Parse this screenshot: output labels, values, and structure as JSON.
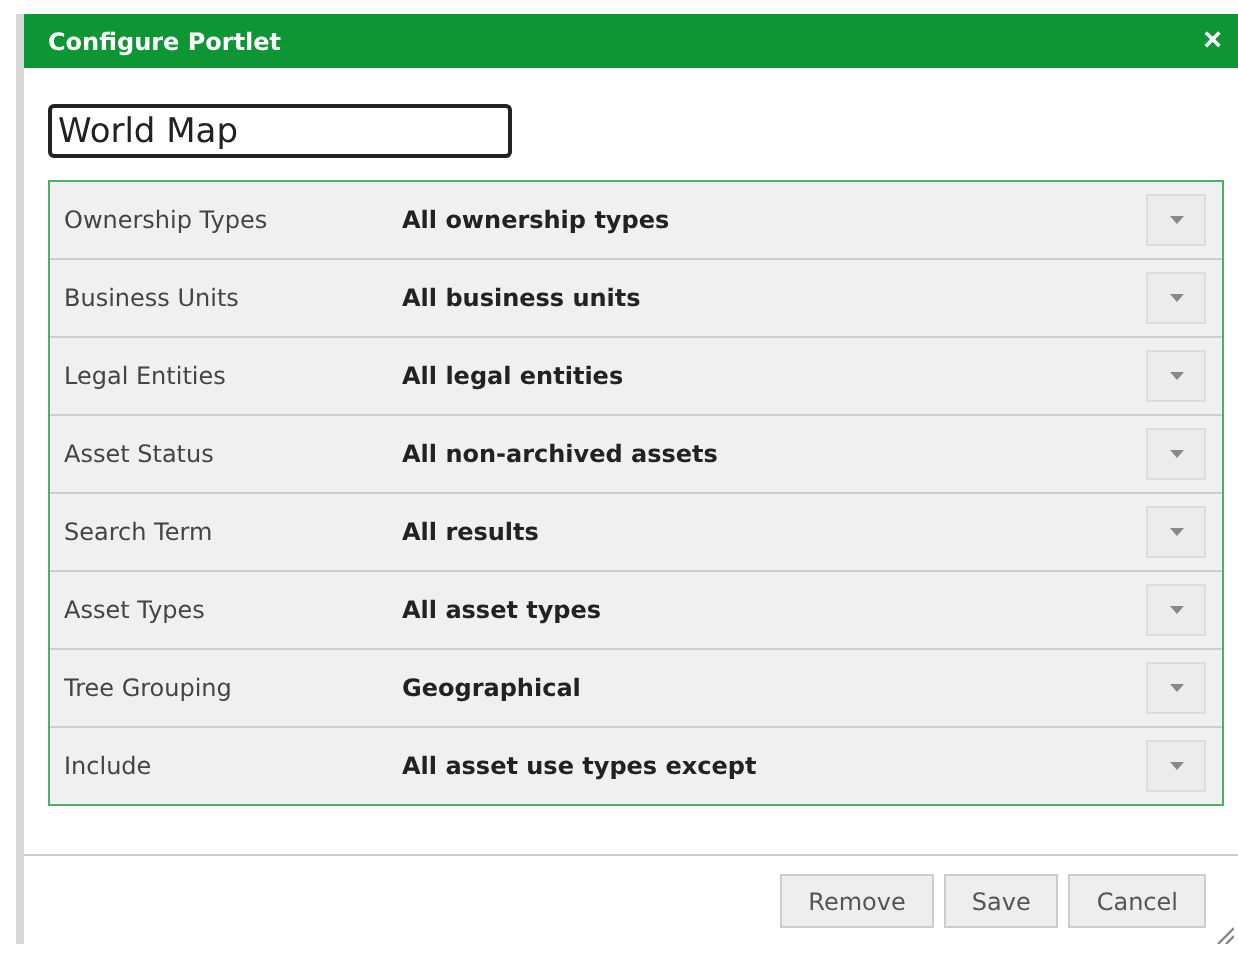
{
  "window": {
    "title": "Configure Portlet",
    "close": "×"
  },
  "name_field": {
    "value": "World Map"
  },
  "settings": [
    {
      "label": "Ownership Types",
      "value": "All ownership types"
    },
    {
      "label": "Business Units",
      "value": "All business units"
    },
    {
      "label": "Legal Entities",
      "value": "All legal entities"
    },
    {
      "label": "Asset Status",
      "value": "All non-archived assets"
    },
    {
      "label": "Search Term",
      "value": "All results"
    },
    {
      "label": "Asset Types",
      "value": "All asset types"
    },
    {
      "label": "Tree Grouping",
      "value": "Geographical"
    },
    {
      "label": "Include",
      "value": "All asset use types except"
    }
  ],
  "buttons": [
    "Remove",
    "Save",
    "Cancel"
  ]
}
